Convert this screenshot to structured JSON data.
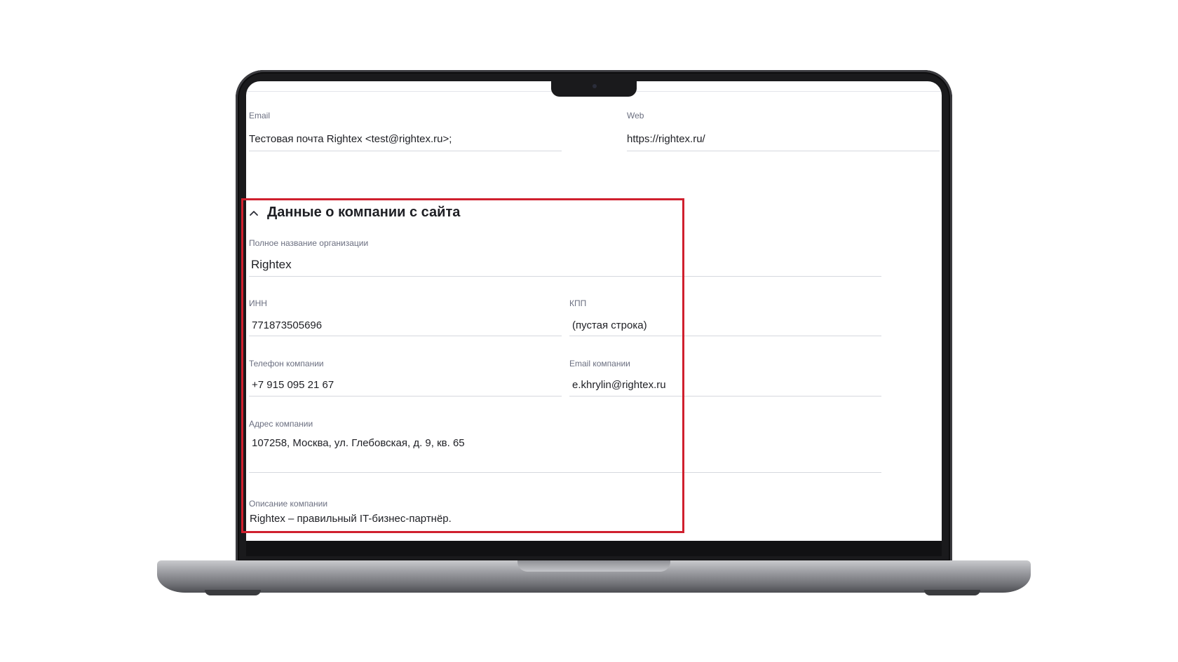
{
  "email": {
    "label": "Email",
    "value": "Тестовая почта Rightex <test@rightex.ru>;"
  },
  "web": {
    "label": "Web",
    "value": "https://rightex.ru/"
  },
  "section": {
    "title": "Данные о компании с сайта",
    "icon": "chevron-up-icon"
  },
  "company": {
    "full_name": {
      "label": "Полное название организации",
      "value": "Rightex"
    },
    "inn": {
      "label": "ИНН",
      "value": "771873505696"
    },
    "kpp": {
      "label": "КПП",
      "value": "(пустая строка)"
    },
    "phone": {
      "label": "Телефон компании",
      "value": "+7 915 095 21 67"
    },
    "email": {
      "label": "Email компании",
      "value": "e.khrylin@rightex.ru"
    },
    "address": {
      "label": "Адрес компании",
      "value": "107258, Москва, ул. Глебовская, д. 9, кв. 65"
    },
    "description": {
      "label": "Описание компании",
      "value": "Rightex – правильный IT-бизнес-партнёр."
    }
  },
  "colors": {
    "highlight": "#d0202e",
    "text": "#1e1f24",
    "label": "#6b6f80",
    "divider": "#d5d8de"
  }
}
